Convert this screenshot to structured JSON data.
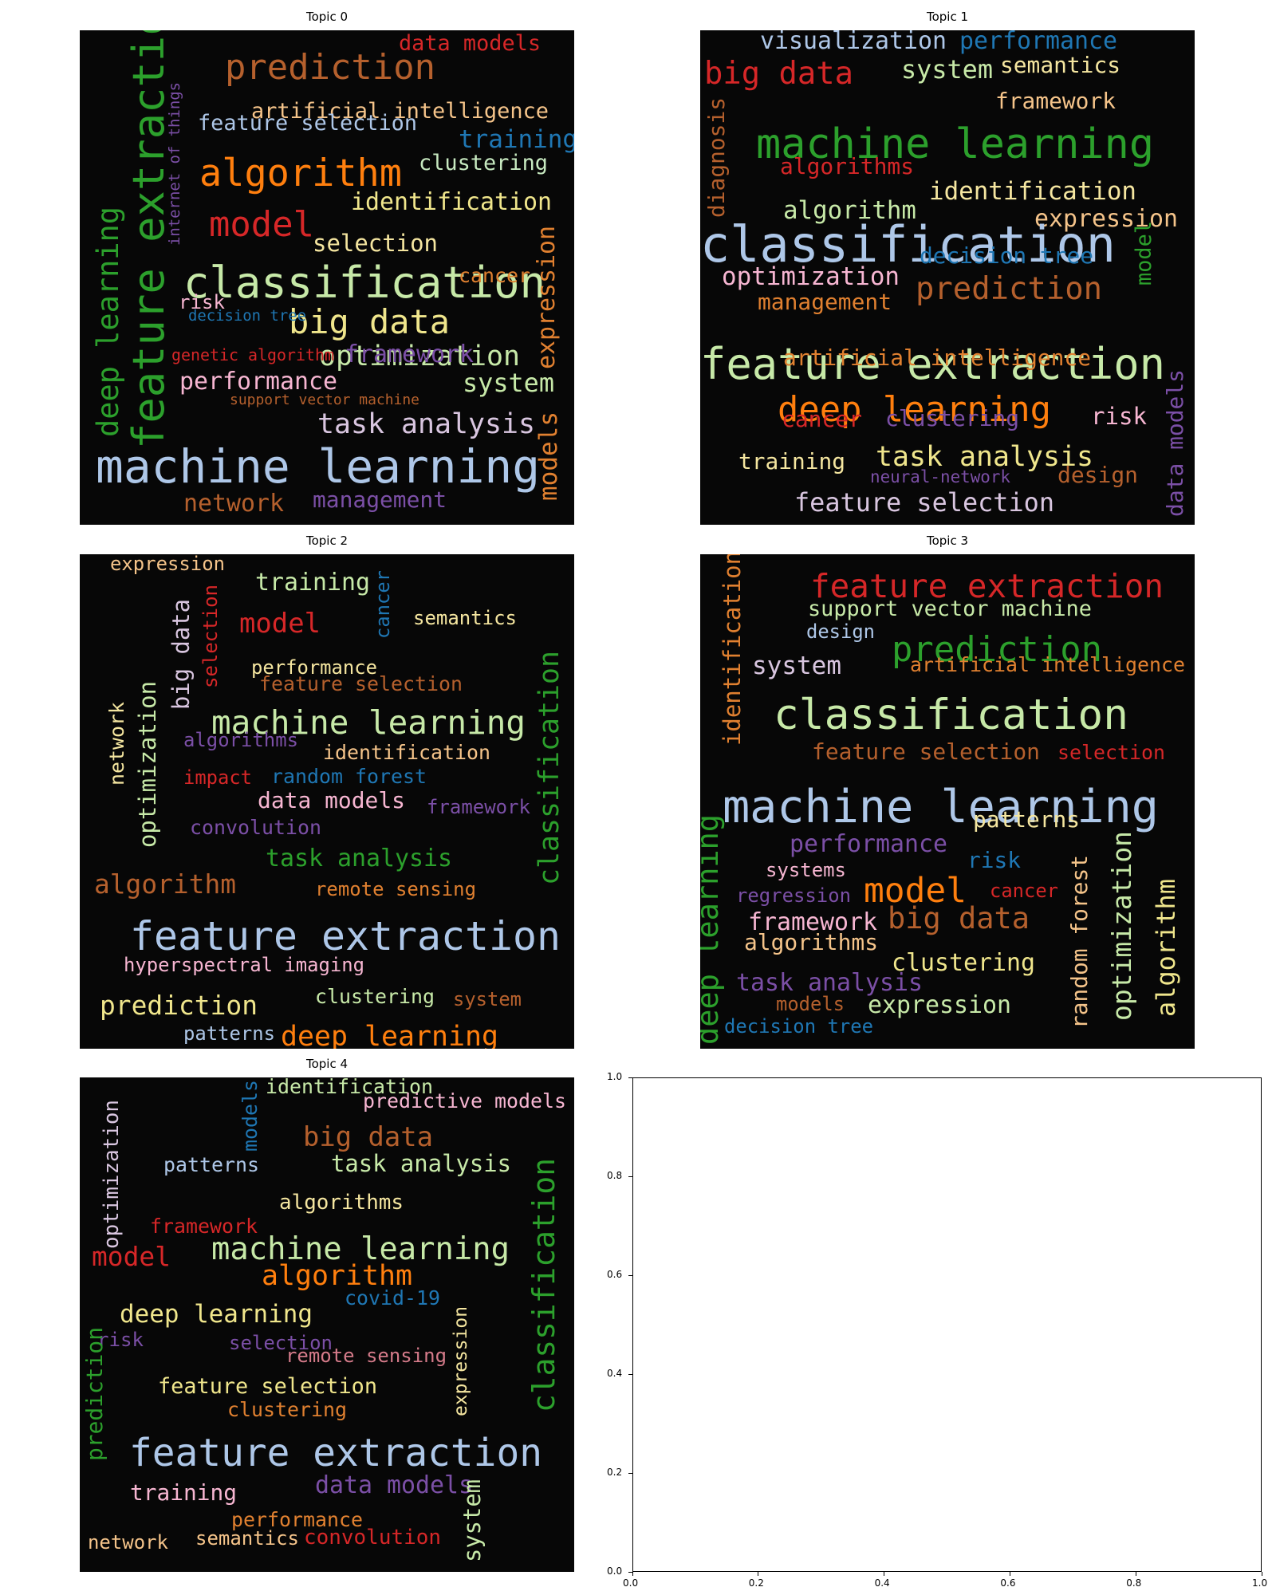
{
  "chart_data": [
    {
      "type": "wordcloud",
      "title": "Topic 0",
      "words": [
        {
          "text": "data models",
          "color": "#d62728"
        },
        {
          "text": "prediction",
          "color": "#b5602d"
        },
        {
          "text": "artificial intelligence",
          "color": "#f5c48a"
        },
        {
          "text": "feature selection",
          "color": "#aec7e8"
        },
        {
          "text": "training",
          "color": "#1f77b4"
        },
        {
          "text": "clustering",
          "color": "#c7e9c0"
        },
        {
          "text": "algorithm",
          "color": "#ff7f0e"
        },
        {
          "text": "identification",
          "color": "#f0e68c"
        },
        {
          "text": "model",
          "color": "#d62728"
        },
        {
          "text": "selection",
          "color": "#f5e6a0"
        },
        {
          "text": "classification",
          "color": "#c7e9a8"
        },
        {
          "text": "cancer",
          "color": "#e08030"
        },
        {
          "text": "risk",
          "color": "#f7b6d2"
        },
        {
          "text": "big data",
          "color": "#f0e68c"
        },
        {
          "text": "decision tree",
          "color": "#1f77b4"
        },
        {
          "text": "optimization",
          "color": "#c7e9a8"
        },
        {
          "text": "genetic algorithm",
          "color": "#d62728"
        },
        {
          "text": "framework",
          "color": "#7b4fa6"
        },
        {
          "text": "performance",
          "color": "#f7b6d2"
        },
        {
          "text": "system",
          "color": "#c7e9a8"
        },
        {
          "text": "support vector machine",
          "color": "#b5602d"
        },
        {
          "text": "task analysis",
          "color": "#d9c6e0"
        },
        {
          "text": "machine learning",
          "color": "#aec7e8"
        },
        {
          "text": "network",
          "color": "#b5602d"
        },
        {
          "text": "management",
          "color": "#7b4fa6"
        },
        {
          "text": "deep learning",
          "color": "#2ca02c"
        },
        {
          "text": "feature extraction",
          "color": "#2ca02c"
        },
        {
          "text": "internet of things",
          "color": "#7b4fa6"
        },
        {
          "text": "expression",
          "color": "#e08030"
        },
        {
          "text": "models",
          "color": "#e08030"
        }
      ]
    },
    {
      "type": "wordcloud",
      "title": "Topic 1",
      "words": [
        {
          "text": "visualization",
          "color": "#aec7e8"
        },
        {
          "text": "performance",
          "color": "#1f77b4"
        },
        {
          "text": "big data",
          "color": "#d62728"
        },
        {
          "text": "system",
          "color": "#c7e9a8"
        },
        {
          "text": "semantics",
          "color": "#f5e6a0"
        },
        {
          "text": "framework",
          "color": "#f5c48a"
        },
        {
          "text": "machine learning",
          "color": "#2ca02c"
        },
        {
          "text": "algorithms",
          "color": "#d62728"
        },
        {
          "text": "identification",
          "color": "#f5e6a0"
        },
        {
          "text": "algorithm",
          "color": "#c7e9a8"
        },
        {
          "text": "expression",
          "color": "#f5c48a"
        },
        {
          "text": "classification",
          "color": "#aec7e8"
        },
        {
          "text": "decision tree",
          "color": "#1f77b4"
        },
        {
          "text": "optimization",
          "color": "#f7b6d2"
        },
        {
          "text": "prediction",
          "color": "#b5602d"
        },
        {
          "text": "management",
          "color": "#e08030"
        },
        {
          "text": "feature extraction",
          "color": "#c7e9a8"
        },
        {
          "text": "artificial intelligence",
          "color": "#e08030"
        },
        {
          "text": "deep learning",
          "color": "#ff7f0e"
        },
        {
          "text": "cancer",
          "color": "#d62728"
        },
        {
          "text": "clustering",
          "color": "#7b4fa6"
        },
        {
          "text": "risk",
          "color": "#f7b6d2"
        },
        {
          "text": "training",
          "color": "#f5e6a0"
        },
        {
          "text": "task analysis",
          "color": "#f0e68c"
        },
        {
          "text": "neural-network",
          "color": "#7b4fa6"
        },
        {
          "text": "design",
          "color": "#b5602d"
        },
        {
          "text": "feature selection",
          "color": "#d9c6e0"
        },
        {
          "text": "diagnosis",
          "color": "#b5602d"
        },
        {
          "text": "model",
          "color": "#2ca02c"
        },
        {
          "text": "data models",
          "color": "#7b4fa6"
        }
      ]
    },
    {
      "type": "wordcloud",
      "title": "Topic 2",
      "words": [
        {
          "text": "expression",
          "color": "#f5c48a"
        },
        {
          "text": "training",
          "color": "#c7e9a8"
        },
        {
          "text": "model",
          "color": "#d62728"
        },
        {
          "text": "semantics",
          "color": "#f5e6a0"
        },
        {
          "text": "performance",
          "color": "#f5e6a0"
        },
        {
          "text": "feature selection",
          "color": "#b5602d"
        },
        {
          "text": "machine learning",
          "color": "#c7e9a8"
        },
        {
          "text": "algorithms",
          "color": "#7b4fa6"
        },
        {
          "text": "identification",
          "color": "#f5c48a"
        },
        {
          "text": "impact",
          "color": "#d62728"
        },
        {
          "text": "random forest",
          "color": "#1f77b4"
        },
        {
          "text": "data models",
          "color": "#f7b6d2"
        },
        {
          "text": "framework",
          "color": "#7b4fa6"
        },
        {
          "text": "convolution",
          "color": "#7b4fa6"
        },
        {
          "text": "task analysis",
          "color": "#2ca02c"
        },
        {
          "text": "algorithm",
          "color": "#b5602d"
        },
        {
          "text": "remote sensing",
          "color": "#e08030"
        },
        {
          "text": "feature extraction",
          "color": "#aec7e8"
        },
        {
          "text": "hyperspectral imaging",
          "color": "#f7b6d2"
        },
        {
          "text": "prediction",
          "color": "#f0e68c"
        },
        {
          "text": "clustering",
          "color": "#c7e9a8"
        },
        {
          "text": "system",
          "color": "#b5602d"
        },
        {
          "text": "patterns",
          "color": "#aec7e8"
        },
        {
          "text": "deep learning",
          "color": "#ff7f0e"
        },
        {
          "text": "network",
          "color": "#f5e6a0"
        },
        {
          "text": "optimization",
          "color": "#c7e9a8"
        },
        {
          "text": "big data",
          "color": "#d9c6e0"
        },
        {
          "text": "selection",
          "color": "#d62728"
        },
        {
          "text": "cancer",
          "color": "#1f77b4"
        },
        {
          "text": "classification",
          "color": "#2ca02c"
        }
      ]
    },
    {
      "type": "wordcloud",
      "title": "Topic 3",
      "words": [
        {
          "text": "feature extraction",
          "color": "#d62728"
        },
        {
          "text": "support vector machine",
          "color": "#c7e9a8"
        },
        {
          "text": "design",
          "color": "#aec7e8"
        },
        {
          "text": "prediction",
          "color": "#2ca02c"
        },
        {
          "text": "system",
          "color": "#d9c6e0"
        },
        {
          "text": "artificial intelligence",
          "color": "#e08030"
        },
        {
          "text": "classification",
          "color": "#c7e9a8"
        },
        {
          "text": "feature selection",
          "color": "#b5602d"
        },
        {
          "text": "selection",
          "color": "#d62728"
        },
        {
          "text": "machine learning",
          "color": "#aec7e8"
        },
        {
          "text": "patterns",
          "color": "#f5e6a0"
        },
        {
          "text": "performance",
          "color": "#7b4fa6"
        },
        {
          "text": "risk",
          "color": "#1f77b4"
        },
        {
          "text": "systems",
          "color": "#f7b6d2"
        },
        {
          "text": "model",
          "color": "#ff7f0e"
        },
        {
          "text": "cancer",
          "color": "#d62728"
        },
        {
          "text": "regression",
          "color": "#7b4fa6"
        },
        {
          "text": "framework",
          "color": "#f7b6d2"
        },
        {
          "text": "big data",
          "color": "#b5602d"
        },
        {
          "text": "algorithms",
          "color": "#f5c48a"
        },
        {
          "text": "clustering",
          "color": "#f0e68c"
        },
        {
          "text": "task analysis",
          "color": "#7b4fa6"
        },
        {
          "text": "models",
          "color": "#b5602d"
        },
        {
          "text": "expression",
          "color": "#c7e9a8"
        },
        {
          "text": "decision tree",
          "color": "#1f77b4"
        },
        {
          "text": "identification",
          "color": "#e08030"
        },
        {
          "text": "deep learning",
          "color": "#2ca02c"
        },
        {
          "text": "random forest",
          "color": "#f5c48a"
        },
        {
          "text": "optimization",
          "color": "#c7e9a8"
        },
        {
          "text": "algorithm",
          "color": "#f0e68c"
        }
      ]
    },
    {
      "type": "wordcloud",
      "title": "Topic 4",
      "words": [
        {
          "text": "identification",
          "color": "#c7e9a8"
        },
        {
          "text": "predictive models",
          "color": "#f7b6d2"
        },
        {
          "text": "big data",
          "color": "#b5602d"
        },
        {
          "text": "patterns",
          "color": "#aec7e8"
        },
        {
          "text": "task analysis",
          "color": "#c7e9a8"
        },
        {
          "text": "algorithms",
          "color": "#f5e6a0"
        },
        {
          "text": "framework",
          "color": "#d62728"
        },
        {
          "text": "model",
          "color": "#d62728"
        },
        {
          "text": "machine learning",
          "color": "#c7e9a8"
        },
        {
          "text": "algorithm",
          "color": "#ff7f0e"
        },
        {
          "text": "covid-19",
          "color": "#1f77b4"
        },
        {
          "text": "deep learning",
          "color": "#f0e68c"
        },
        {
          "text": "risk",
          "color": "#7b4fa6"
        },
        {
          "text": "selection",
          "color": "#7b4fa6"
        },
        {
          "text": "remote sensing",
          "color": "#d57b8a"
        },
        {
          "text": "feature selection",
          "color": "#f0e68c"
        },
        {
          "text": "clustering",
          "color": "#e08030"
        },
        {
          "text": "feature extraction",
          "color": "#aec7e8"
        },
        {
          "text": "data models",
          "color": "#7b4fa6"
        },
        {
          "text": "training",
          "color": "#f7b6d2"
        },
        {
          "text": "performance",
          "color": "#e08030"
        },
        {
          "text": "network",
          "color": "#f5c48a"
        },
        {
          "text": "semantics",
          "color": "#f5c48a"
        },
        {
          "text": "convolution",
          "color": "#d62728"
        },
        {
          "text": "optimization",
          "color": "#d9c6e0"
        },
        {
          "text": "models",
          "color": "#1f77b4"
        },
        {
          "text": "prediction",
          "color": "#2ca02c"
        },
        {
          "text": "expression",
          "color": "#f5e6a0"
        },
        {
          "text": "classification",
          "color": "#2ca02c"
        },
        {
          "text": "system",
          "color": "#c7e9a8"
        }
      ]
    },
    {
      "type": "empty_axes",
      "xlim": [
        0.0,
        1.0
      ],
      "ylim": [
        0.0,
        1.0
      ],
      "xticks": [
        "0.0",
        "0.2",
        "0.4",
        "0.6",
        "0.8",
        "1.0"
      ],
      "yticks": [
        "0.0",
        "0.2",
        "0.4",
        "0.6",
        "0.8",
        "1.0"
      ]
    }
  ]
}
